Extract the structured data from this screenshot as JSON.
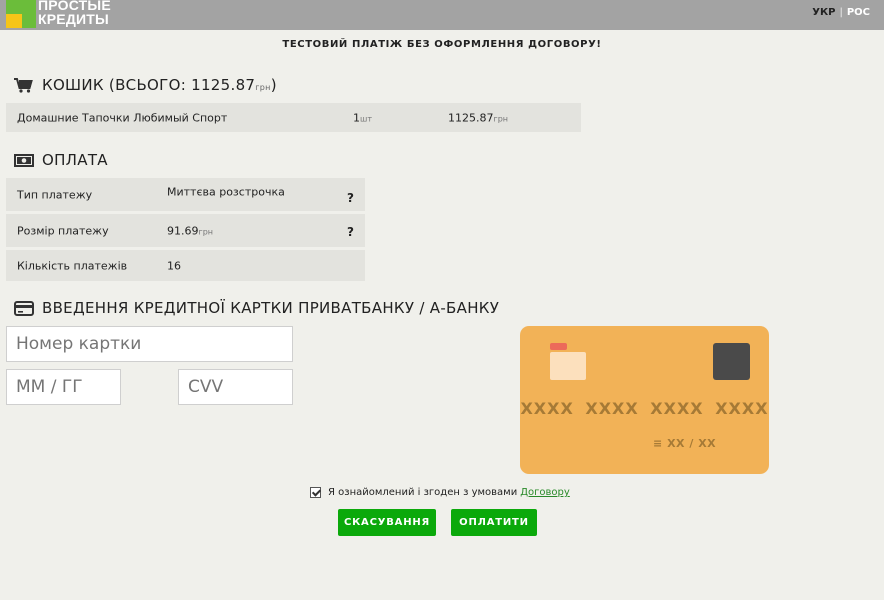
{
  "header": {
    "logo_line1": "ПРОСТЫЕ",
    "logo_line2": "КРЕДИТЫ",
    "lang_current": "УКР",
    "lang_separator": "|",
    "lang_other": "РОС"
  },
  "notice": "ТЕСТОВИЙ ПЛАТІЖ БЕЗ ОФОРМЛЕННЯ ДОГОВОРУ!",
  "cart": {
    "title": "КОШИК (ВСЬОГО: 1125.87",
    "title_unit": "грн",
    "title_close": ")",
    "item_name": "Домашние Тапочки Любимый Спорт",
    "item_qty": "1",
    "item_qty_unit": "шт",
    "item_price": "1125.87",
    "item_price_unit": "грн"
  },
  "payment": {
    "title": "ОПЛАТА",
    "rows": [
      {
        "label": "Тип платежу",
        "value": "Миттєва розстрочка",
        "unit": "",
        "help": "?"
      },
      {
        "label": "Розмір платежу",
        "value": "91.69",
        "unit": "грн",
        "help": "?"
      },
      {
        "label": "Кількість платежів",
        "value": "16",
        "unit": "",
        "help": ""
      }
    ]
  },
  "card_entry": {
    "title": "ВВЕДЕННЯ КРЕДИТНОЇ КАРТКИ ПРИВАТБАНКУ / А-БАНКУ",
    "card_number_placeholder": "Номер картки",
    "expiry_placeholder": "ММ / ГГ",
    "cvv_placeholder": "CVV"
  },
  "card_preview": {
    "number": "XXXX XXXX XXXX XXXX",
    "expiry_prefix": "≡",
    "expiry": "XX / XX",
    "colors": {
      "body": "#f2b257",
      "chip": "#4a4a4a",
      "accent": "#ec6a5a"
    }
  },
  "agreement": {
    "text": "Я ознайомлений і згоден з умовами",
    "link": "Договору"
  },
  "buttons": {
    "cancel": "СКАСУВАННЯ",
    "pay": "ОПЛАТИТИ"
  },
  "colors": {
    "primary": "#0ba90b",
    "header_bg": "#a3a3a3",
    "row_bg": "#e3e3de"
  }
}
